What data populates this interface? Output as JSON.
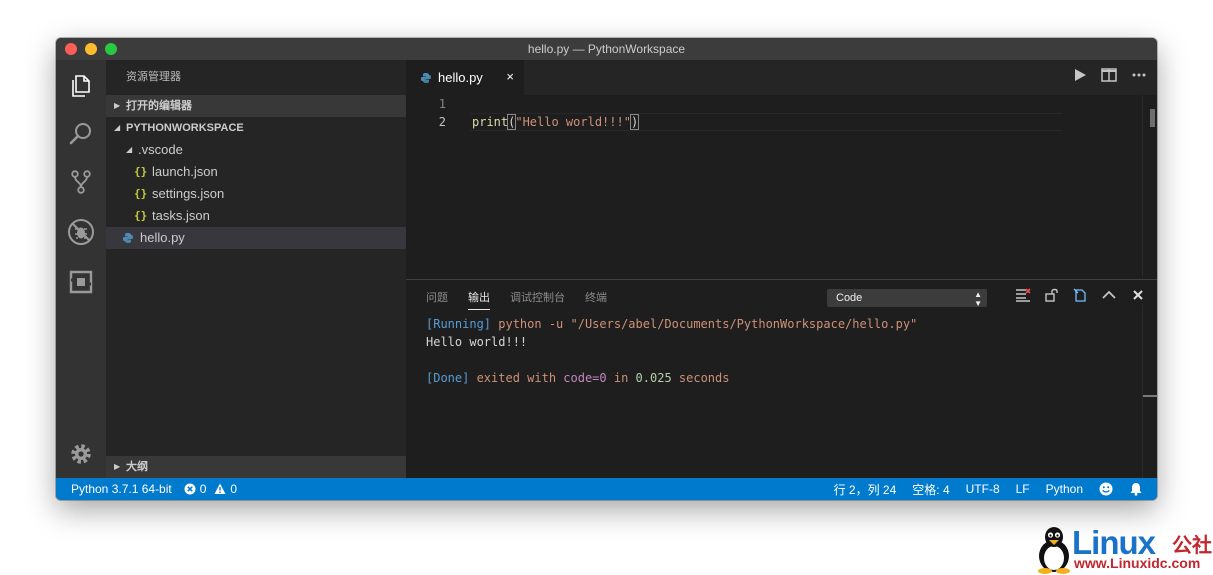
{
  "window": {
    "title": "hello.py — PythonWorkspace"
  },
  "sidebar": {
    "header": "资源管理器",
    "open_editors": "打开的编辑器",
    "workspace": "PYTHONWORKSPACE",
    "folder": ".vscode",
    "json_icon": "{}",
    "files": [
      "launch.json",
      "settings.json",
      "tasks.json"
    ],
    "active_file": "hello.py",
    "outline": "大纲"
  },
  "editor": {
    "tab_label": "hello.py",
    "tab_close": "×",
    "line_numbers": [
      "1",
      "2"
    ],
    "code": {
      "fn": "print",
      "open": "(",
      "str": "\"Hello world!!!\"",
      "close": ")"
    }
  },
  "panel": {
    "tabs": [
      "问题",
      "输出",
      "调试控制台",
      "终端"
    ],
    "active_tab": "输出",
    "channel": "Code",
    "output": {
      "running_tag": "[Running]",
      "running_cmd": " python -u \"/Users/abel/Documents/PythonWorkspace/hello.py\"",
      "result": "Hello world!!!",
      "done_tag": "[Done]",
      "done_1": " exited with ",
      "done_code": "code=0",
      "done_2": " in ",
      "done_time": "0.025",
      "done_3": " seconds"
    }
  },
  "statusbar": {
    "interpreter": "Python 3.7.1 64-bit",
    "errors": "0",
    "warnings": "0",
    "position": "行 2，列 24",
    "spaces": "空格: 4",
    "encoding": "UTF-8",
    "eol": "LF",
    "language": "Python"
  },
  "watermark": {
    "brand": "Linux",
    "cn": "公社",
    "url": "www.Linuxidc.com"
  },
  "colors": {
    "statusbar": "#007acc",
    "activitybar": "#333333",
    "sidebar": "#252526",
    "editor": "#1e1e1e"
  }
}
